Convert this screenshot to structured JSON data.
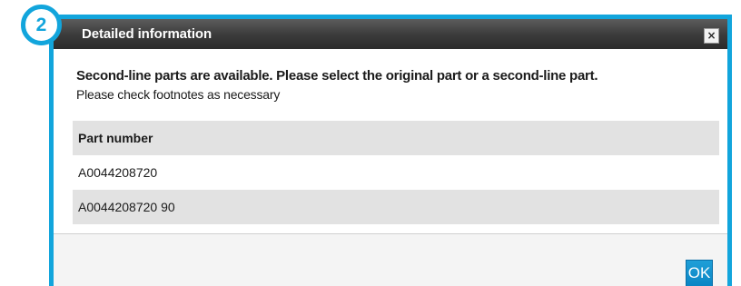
{
  "step_badge": "2",
  "dialog": {
    "title": "Detailed information",
    "close_glyph": "×",
    "message_main": "Second-line parts are available. Please select the original part or a second-line part.",
    "message_sub": "Please check footnotes as necessary"
  },
  "table": {
    "header": "Part number",
    "rows": [
      "A0044208720",
      "A0044208720 90"
    ]
  },
  "buttons": {
    "ok_label": "OK"
  },
  "colors": {
    "accent": "#12a5dc",
    "titlebar": "#3a3a3a",
    "row_alt": "#e2e2e2",
    "ok_button": "#0a85c4"
  }
}
